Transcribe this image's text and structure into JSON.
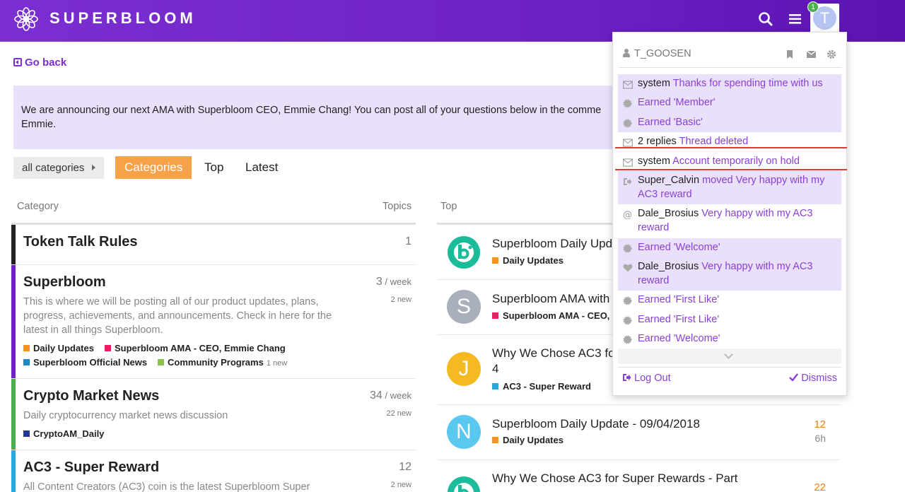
{
  "header": {
    "brand": "SUPERBLOOM",
    "notification_count": "1",
    "avatar_letter": "T"
  },
  "go_back": "Go back",
  "banner": {
    "text": "We are announcing our next AMA with Superbloom CEO, Emmie Chang! You can post all of your questions below in the comme Emmie."
  },
  "nav": {
    "category_select": "all categories",
    "tabs": [
      "Categories",
      "Top",
      "Latest"
    ]
  },
  "category_table": {
    "col_category": "Category",
    "col_topics": "Topics",
    "rows": [
      {
        "name": "Token Talk Rules",
        "count": "1",
        "count_suffix": "",
        "new": "",
        "color": "#222222",
        "desc": ""
      },
      {
        "name": "Superbloom",
        "count": "3",
        "count_suffix": " / week",
        "new": "2 new",
        "color": "#6d22c6",
        "desc": "This is where we will be posting all of our product updates, plans, progress, achievements, and announcements. Check in here for the latest in all things Superbloom.",
        "subs": [
          {
            "name": "Daily Updates",
            "color": "#f7941d",
            "new": ""
          },
          {
            "name": "Superbloom AMA - CEO, Emmie Chang",
            "color": "#e91e63",
            "new": ""
          },
          {
            "name": "Superbloom Official News",
            "color": "#1e88c7",
            "new": ""
          },
          {
            "name": "Community Programs",
            "color": "#8bc34a",
            "new": "1 new"
          }
        ]
      },
      {
        "name": "Crypto Market News",
        "count": "34",
        "count_suffix": " / week",
        "new": "22 new",
        "color": "#4caf50",
        "desc": "Daily cryptocurrency market news discussion",
        "subs": [
          {
            "name": "CryptoAM_Daily",
            "color": "#283593",
            "new": ""
          }
        ]
      },
      {
        "name": "AC3 - Super Reward",
        "count": "12",
        "count_suffix": "",
        "new": "2 new",
        "color": "#29a8e0",
        "desc": "All Content Creators (AC3) coin is the latest Superbloom Super"
      }
    ]
  },
  "top_list": {
    "col_top": "Top",
    "rows": [
      {
        "title": "Superbloom Daily Upd",
        "cat": "Daily Updates",
        "cat_color": "#f7941d",
        "avatar": "bi",
        "avatar_color": "#1abc9c",
        "num": "",
        "age": ""
      },
      {
        "title": "Superbloom AMA with",
        "cat": "Superbloom AMA - CEO,",
        "cat_color": "#e91e63",
        "avatar": "S",
        "avatar_color": "#aab0bb",
        "num": "",
        "age": ""
      },
      {
        "title": "Why We Chose AC3 fo",
        "title2": "4",
        "cat": "AC3 - Super Reward",
        "cat_color": "#29a8e0",
        "avatar": "J",
        "avatar_color": "#f5b921",
        "num": "",
        "age": ""
      },
      {
        "title": "Superbloom Daily Update - 09/04/2018",
        "cat": "Daily Updates",
        "cat_color": "#f7941d",
        "avatar": "N",
        "avatar_color": "#5bc8ef",
        "num": "12",
        "age": "6h"
      },
      {
        "title": "Why We Chose AC3 for Super Rewards - Part",
        "cat": "",
        "cat_color": "#29a8e0",
        "avatar": "bi",
        "avatar_color": "#1abc9c",
        "num": "22",
        "age": ""
      }
    ]
  },
  "user_menu": {
    "username": "T_GOOSEN",
    "notifications": [
      {
        "actor": "system",
        "text": "Thanks for spending time with us",
        "icon": "envelope-icon",
        "unread": true
      },
      {
        "actor": "",
        "text": "Earned 'Member'",
        "icon": "badge-icon",
        "unread": true
      },
      {
        "actor": "",
        "text": "Earned 'Basic'",
        "icon": "badge-icon",
        "unread": true
      },
      {
        "actor": "2 replies",
        "text": "Thread deleted",
        "icon": "envelope-icon",
        "unread": false
      },
      {
        "actor": "system",
        "text": "Account temporarily on hold",
        "icon": "envelope-icon",
        "unread": false
      },
      {
        "actor": "Super_Calvin",
        "text": "moved Very happy with my AC3 reward",
        "icon": "moved-icon",
        "unread": true
      },
      {
        "actor": "Dale_Brosius",
        "text": "Very happy with my AC3 reward",
        "icon": "at-icon",
        "unread": false
      },
      {
        "actor": "",
        "text": "Earned 'Welcome'",
        "icon": "badge-icon",
        "unread": true
      },
      {
        "actor": "Dale_Brosius",
        "text": "Very happy with my AC3 reward",
        "icon": "heart-icon",
        "unread": true
      },
      {
        "actor": "",
        "text": "Earned 'First Like'",
        "icon": "badge-icon",
        "unread": false
      },
      {
        "actor": "",
        "text": "Earned 'First Like'",
        "icon": "badge-icon",
        "unread": false
      },
      {
        "actor": "",
        "text": "Earned 'Welcome'",
        "icon": "badge-icon",
        "unread": false
      }
    ],
    "logout": "Log Out",
    "dismiss": "Dismiss"
  },
  "colors": {
    "brand": "#6d22c6",
    "accent": "#f7a148",
    "link": "#8a3fd8",
    "unread_bg": "#e9e0fb",
    "highlight_line": "#e53935"
  }
}
